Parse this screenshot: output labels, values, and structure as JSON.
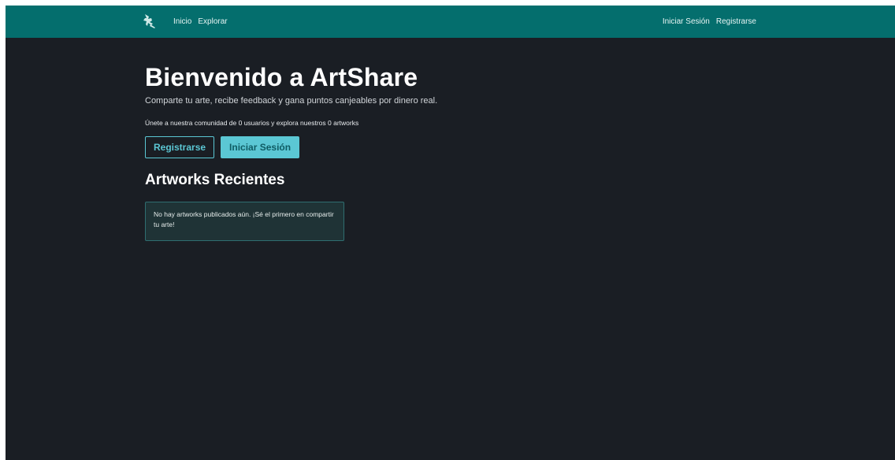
{
  "navbar": {
    "logo_icon": "brush-logo-icon",
    "left_links": [
      "Inicio",
      "Explorar"
    ],
    "right_links": [
      "Iniciar Sesión",
      "Registrarse"
    ],
    "background_color": "#046e6d"
  },
  "hero": {
    "title": "Bienvenido a ArtShare",
    "subtitle": "Comparte tu arte, recibe feedback y gana puntos canjeables por dinero real.",
    "stats": "Únete a nuestra comunidad de 0 usuarios y explora nuestros 0 artworks",
    "register_button": "Registrarse",
    "login_button": "Iniciar Sesión",
    "accent_color": "#5bc7d4"
  },
  "recent": {
    "title": "Artworks Recientes",
    "empty_message": "No hay artworks publicados aún. ¡Sé el primero en compartir tu arte!"
  }
}
